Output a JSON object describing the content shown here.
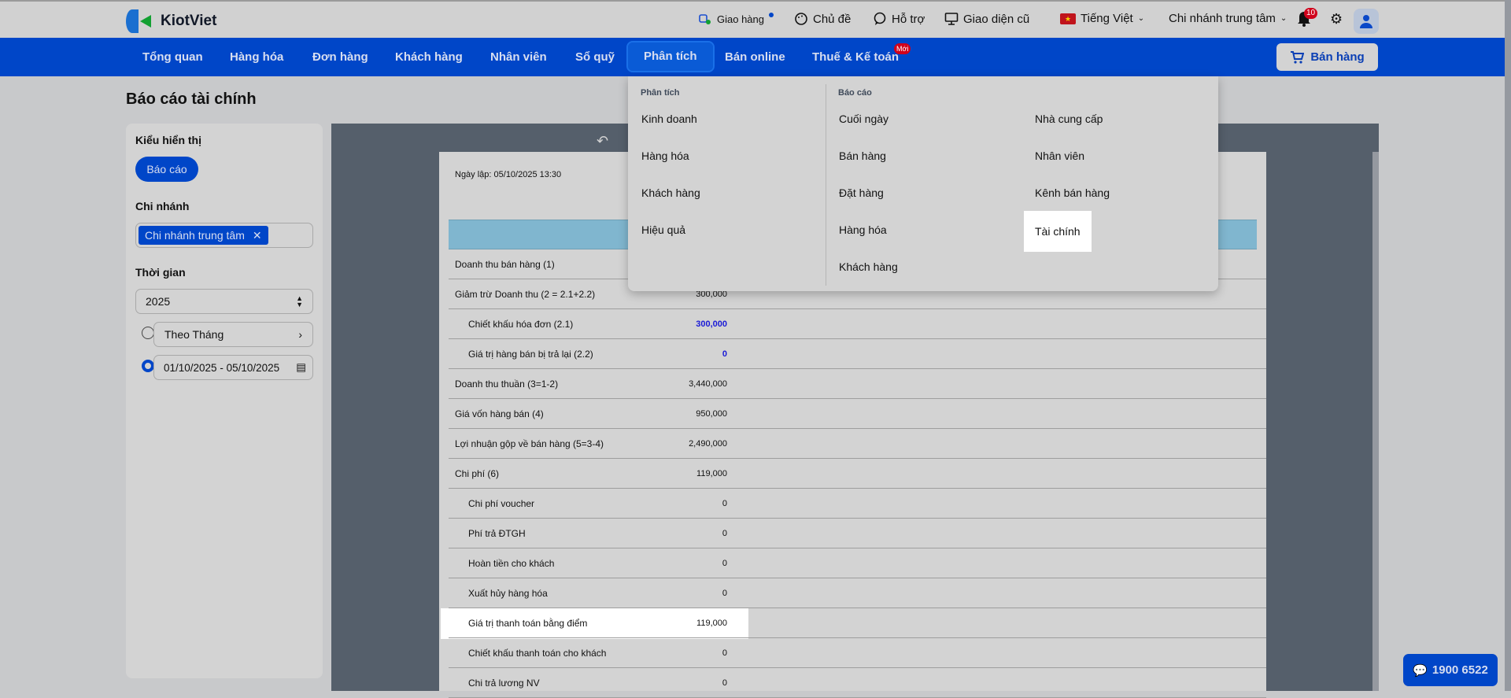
{
  "brand": {
    "name": "KiotViet"
  },
  "topbar": {
    "delivery": "Giao hàng",
    "theme": "Chủ đề",
    "support": "Hỗ trợ",
    "old_ui": "Giao diện cũ",
    "language": "Tiếng Việt",
    "branch": "Chi nhánh trung tâm",
    "notifications": "10"
  },
  "nav": {
    "items": [
      "Tổng quan",
      "Hàng hóa",
      "Đơn hàng",
      "Khách hàng",
      "Nhân viên",
      "Sổ quỹ",
      "Phân tích",
      "Bán online",
      "Thuế & Kế toán"
    ],
    "new_badge": "Mới",
    "sell": "Bán hàng"
  },
  "page": {
    "title": "Báo cáo tài chính"
  },
  "filters": {
    "display_label": "Kiểu hiển thị",
    "display_value": "Báo cáo",
    "branch_label": "Chi nhánh",
    "branch_tag": "Chi nhánh trung tâm",
    "time_label": "Thời gian",
    "year": "2025",
    "period": "Theo Tháng",
    "date_range": "01/10/2025 - 05/10/2025"
  },
  "report": {
    "created": "Ngày lập: 05/10/2025 13:30",
    "rows": [
      {
        "label": "Doanh thu bán hàng (1)",
        "value": ""
      },
      {
        "label": "Giảm trừ Doanh thu (2 = 2.1+2.2)",
        "value": "300,000"
      },
      {
        "label": "Chiết khấu hóa đơn (2.1)",
        "value": "300,000"
      },
      {
        "label": "Giá trị hàng bán bị trả lại (2.2)",
        "value": "0"
      },
      {
        "label": "Doanh thu thuần (3=1-2)",
        "value": "3,440,000"
      },
      {
        "label": "Giá vốn hàng bán (4)",
        "value": "950,000"
      },
      {
        "label": "Lợi nhuận gộp về bán hàng (5=3-4)",
        "value": "2,490,000"
      },
      {
        "label": "Chi phí (6)",
        "value": "119,000"
      },
      {
        "label": "Chi phí voucher",
        "value": "0"
      },
      {
        "label": "Phí trả ĐTGH",
        "value": "0"
      },
      {
        "label": "Hoàn tiền cho khách",
        "value": "0"
      },
      {
        "label": "Xuất hủy hàng hóa",
        "value": "0"
      },
      {
        "label": "Giá trị thanh toán bằng điểm",
        "value": "119,000"
      },
      {
        "label": "Chiết khấu thanh toán cho khách",
        "value": "0"
      },
      {
        "label": "Chi trả lương NV",
        "value": "0"
      }
    ]
  },
  "menu": {
    "analysis_header": "Phân tích",
    "analysis": [
      "Kinh doanh",
      "Hàng hóa",
      "Khách hàng",
      "Hiệu quả"
    ],
    "reports_header": "Báo cáo",
    "reports_col1": [
      "Cuối ngày",
      "Bán hàng",
      "Đặt hàng",
      "Hàng hóa",
      "Khách hàng"
    ],
    "reports_col2": [
      "Nhà cung cấp",
      "Nhân viên",
      "Kênh bán hàng",
      "Tài chính"
    ]
  },
  "hotline": "1900 6522",
  "colors": {
    "primary": "#0046c8",
    "new_badge": "#d0021b",
    "report_header": "#80b6cf"
  }
}
